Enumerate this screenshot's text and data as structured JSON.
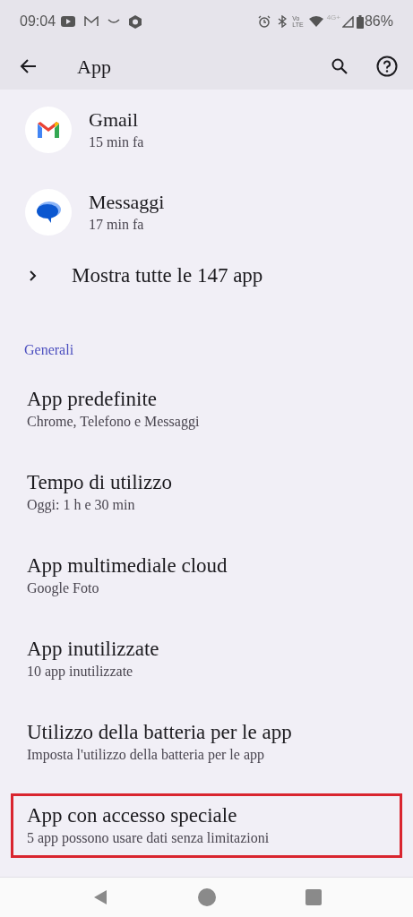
{
  "status_bar": {
    "time": "09:04",
    "volte": [
      "Vo",
      "LTE"
    ],
    "network": "4G+",
    "battery": "86%"
  },
  "app_bar": {
    "title": "App"
  },
  "recent_apps": [
    {
      "kind": "gmail",
      "name": "Gmail",
      "subtitle": "15 min fa"
    },
    {
      "kind": "messages",
      "name": "Messaggi",
      "subtitle": "17 min fa"
    }
  ],
  "show_all": "Mostra tutte le 147 app",
  "section": "Generali",
  "items": [
    {
      "title": "App predefinite",
      "subtitle": "Chrome, Telefono e Messaggi",
      "highlighted": false
    },
    {
      "title": "Tempo di utilizzo",
      "subtitle": "Oggi: 1 h e 30 min",
      "highlighted": false
    },
    {
      "title": "App multimediale cloud",
      "subtitle": "Google Foto",
      "highlighted": false
    },
    {
      "title": "App inutilizzate",
      "subtitle": "10 app inutilizzate",
      "highlighted": false
    },
    {
      "title": "Utilizzo della batteria per le app",
      "subtitle": "Imposta l'utilizzo della batteria per le app",
      "highlighted": false
    },
    {
      "title": "App con accesso speciale",
      "subtitle": "5 app possono usare dati senza limitazioni",
      "highlighted": true
    }
  ]
}
